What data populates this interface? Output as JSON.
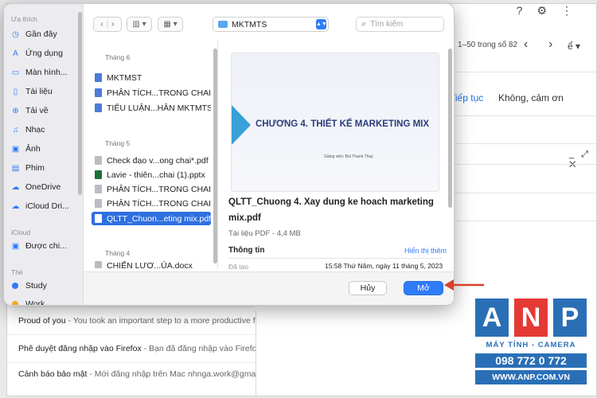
{
  "background": {
    "top_icons": [
      "?",
      "⚙",
      "⋮"
    ],
    "pager_text": "1–50 trong số 82",
    "nav_prev": "‹",
    "nav_next": "›",
    "lang_icon": "ể ▾",
    "tiep_tuc": "Tiếp tục",
    "khong_cam_on": "Không, cảm ơn",
    "window_controls": "_ ⤢ ✕",
    "emails": [
      {
        "sender": "Proud of you",
        "snippet": " - You took an important step to a more productive fut"
      },
      {
        "sender": "Phê duyệt đăng nhập vào Firefox",
        "snippet": " - Bạn đã đăng nhập vào Firefox c"
      },
      {
        "sender": "Cảnh báo bảo mật",
        "snippet": " - Mới đăng nhập trên Mac nhnga.work@gmail.c"
      }
    ]
  },
  "dialog": {
    "sidebar": {
      "favorites_header": "Ưa thích",
      "favorites": [
        {
          "icon": "clock-icon",
          "glyph": "◷",
          "label": "Gần đây"
        },
        {
          "icon": "apps-icon",
          "glyph": "A",
          "label": "Ứng dụng"
        },
        {
          "icon": "desktop-icon",
          "glyph": "▭",
          "label": "Màn hình..."
        },
        {
          "icon": "document-icon",
          "glyph": "▯",
          "label": "Tài liệu"
        },
        {
          "icon": "download-icon",
          "glyph": "⊕",
          "label": "Tải về"
        },
        {
          "icon": "music-icon",
          "glyph": "♫",
          "label": "Nhạc"
        },
        {
          "icon": "photo-icon",
          "glyph": "▣",
          "label": "Ảnh"
        },
        {
          "icon": "film-icon",
          "glyph": "▤",
          "label": "Phim"
        },
        {
          "icon": "cloud-icon",
          "glyph": "☁",
          "label": "OneDrive"
        },
        {
          "icon": "cloud-icon",
          "glyph": "☁",
          "label": "iCloud Dri..."
        }
      ],
      "icloud_header": "iCloud",
      "icloud": [
        {
          "icon": "shared-folder-icon",
          "glyph": "▣",
          "label": "Được chi..."
        }
      ],
      "tags_header": "Thẻ",
      "tags": [
        {
          "color": "#2f7cf6",
          "label": "Study"
        },
        {
          "color": "#f5a623",
          "label": "Work"
        }
      ]
    },
    "toolbar": {
      "back": "‹",
      "forward": "›",
      "view_icon": "▥ ▾",
      "group_icon": "▦ ▾"
    },
    "location": "MKTMTS",
    "search_placeholder": "Tìm kiếm",
    "files": {
      "groups": [
        {
          "header": "Tháng 6",
          "items": [
            {
              "type": "doc",
              "name": "MKTMST"
            },
            {
              "type": "doc",
              "name": "PHÂN TÍCH...TRONG CHAI*"
            },
            {
              "type": "doc",
              "name": "TIỂU LUẬN...HÂN MKTMTS"
            }
          ]
        },
        {
          "header": "Tháng 5",
          "items": [
            {
              "type": "pdf",
              "name": "Check đạo v...ong chai*.pdf"
            },
            {
              "type": "ppt",
              "name": "Lavie - thiên...chai (1).pptx"
            },
            {
              "type": "pdf",
              "name": "PHÂN TÍCH...TRONG CHAI"
            },
            {
              "type": "pdf",
              "name": "PHÂN TÍCH...TRONG CHAI"
            },
            {
              "type": "sel",
              "name": "QLTT_Chuon...eting mix.pdf",
              "selected": true
            }
          ]
        },
        {
          "header": "Tháng 4",
          "items": [
            {
              "type": "pdf",
              "name": "CHIẾN LƯỢ...ỦA.docx"
            }
          ]
        }
      ]
    },
    "preview": {
      "slide_title": "CHƯƠNG 4. THIẾT KẾ MARKETING MIX",
      "slide_author": "Giảng viên: Bùi Thanh Thuỷ",
      "file_name": "QLTT_Chuong 4. Xay dung ke hoach marketing mix.pdf",
      "file_meta": "Tài liệu PDF - 4,4 MB",
      "info_label": "Thông tin",
      "show_more": "Hiển thị thêm",
      "created_label": "Đã tạo",
      "created_value": "15:58 Thứ Năm, ngày 11 tháng 5, 2023"
    },
    "buttons": {
      "cancel": "Hủy",
      "open": "Mở"
    }
  },
  "watermark": {
    "letters": [
      "A",
      "N",
      "P"
    ],
    "letter_colors": [
      "#2a6fb6",
      "#e53935",
      "#2a6fb6"
    ],
    "tagline": "MÁY TÍNH - CAMERA",
    "phone": "098 772 0 772",
    "website": "WWW.ANP.COM.VN"
  },
  "colors": {
    "accent": "#2f7cf6",
    "arrow": "#d6402c"
  }
}
